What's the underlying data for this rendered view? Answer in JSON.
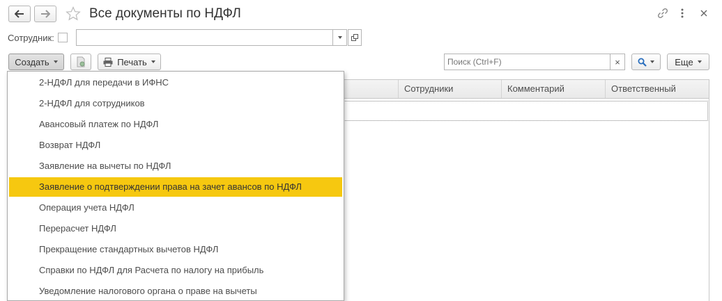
{
  "window": {
    "title": "Все документы по НДФЛ"
  },
  "filter": {
    "employee_label": "Сотрудник:",
    "employee_value": ""
  },
  "toolbar": {
    "create_label": "Создать",
    "print_label": "Печать",
    "search_placeholder": "Поиск (Ctrl+F)",
    "clear_symbol": "×",
    "more_label": "Еще"
  },
  "table": {
    "columns": [
      "Сотрудники",
      "Комментарий",
      "Ответственный"
    ]
  },
  "create_menu": {
    "items": [
      "2-НДФЛ для передачи в ИФНС",
      "2-НДФЛ для сотрудников",
      "Авансовый платеж по НДФЛ",
      "Возврат НДФЛ",
      "Заявление на вычеты по НДФЛ",
      "Заявление о подтверждении права на зачет авансов по НДФЛ",
      "Операция учета НДФЛ",
      "Перерасчет НДФЛ",
      "Прекращение стандартных вычетов НДФЛ",
      "Справки по НДФЛ для Расчета по налогу на прибыль",
      "Уведомление налогового органа о праве на вычеты"
    ],
    "highlighted_index": 5,
    "highlight_color": "#f6c810"
  },
  "icons": [
    "back-arrow-icon",
    "forward-arrow-icon",
    "favorite-star-icon",
    "link-icon",
    "more-vertical-icon",
    "close-icon",
    "open-icon",
    "copy-doc-icon",
    "printer-icon",
    "search-icon"
  ]
}
